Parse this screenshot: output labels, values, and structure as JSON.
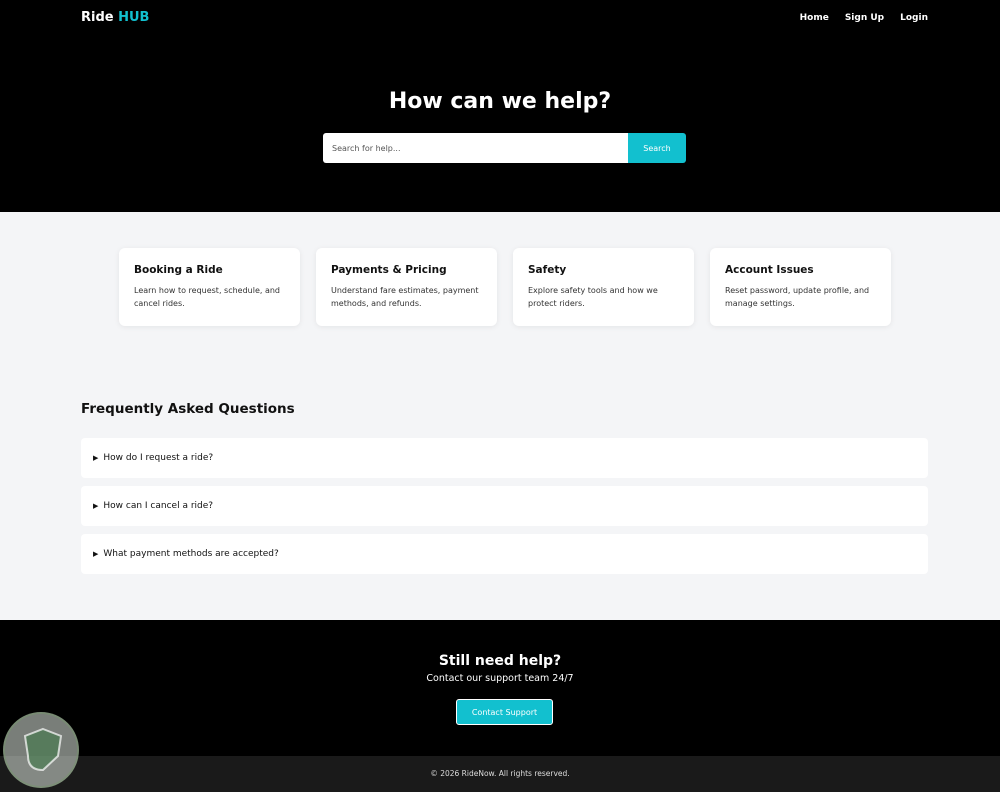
{
  "header": {
    "brand_part1": "Ride",
    "brand_part2": "HUB",
    "nav": [
      "Home",
      "Sign Up",
      "Login"
    ]
  },
  "hero": {
    "title": "How can we help?",
    "search_placeholder": "Search for help...",
    "search_button": "Search"
  },
  "categories": [
    {
      "title": "Booking a Ride",
      "desc": "Learn how to request, schedule, and cancel rides."
    },
    {
      "title": "Payments & Pricing",
      "desc": "Understand fare estimates, payment methods, and refunds."
    },
    {
      "title": "Safety",
      "desc": "Explore safety tools and how we protect riders."
    },
    {
      "title": "Account Issues",
      "desc": "Reset password, update profile, and manage settings."
    }
  ],
  "faq": {
    "title": "Frequently Asked Questions",
    "items": [
      "How do I request a ride?",
      "How can I cancel a ride?",
      "What payment methods are accepted?"
    ]
  },
  "help": {
    "title": "Still need help?",
    "subtitle": "Contact our support team 24/7",
    "button": "Contact Support"
  },
  "footer": {
    "text": "© 2026 RideNow. All rights reserved."
  },
  "colors": {
    "accent": "#12c0cf",
    "dark": "#000000",
    "page_bg": "#f4f5f7"
  }
}
